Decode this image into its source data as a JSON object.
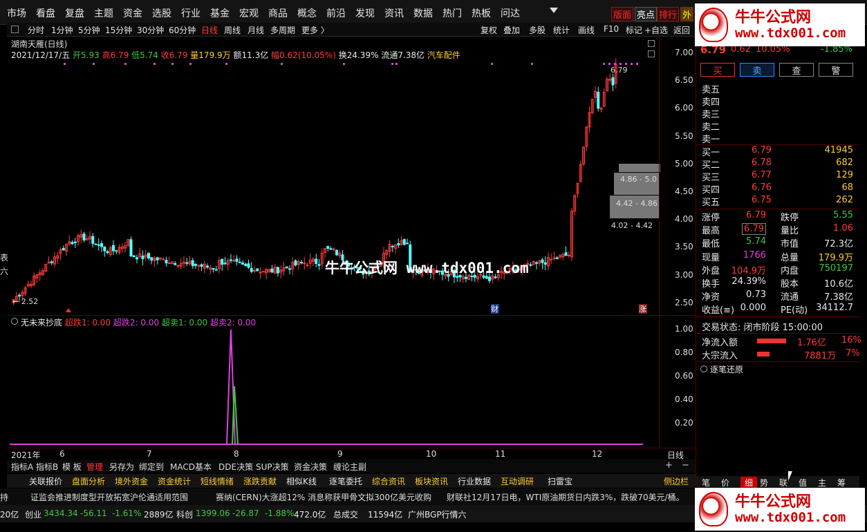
{
  "menubar": {
    "items": [
      "市场",
      "看盘",
      "复盘",
      "主题",
      "资金",
      "选股",
      "行业",
      "基金",
      "宏观",
      "商品",
      "概念",
      "前沿",
      "发现",
      "资讯",
      "数据",
      "热门",
      "热板",
      "问达"
    ],
    "right_tabs": [
      "版面",
      "亮点",
      "排行",
      "外"
    ]
  },
  "periodbar": {
    "items": [
      "分时",
      "1分钟",
      "5分钟",
      "15分钟",
      "30分钟",
      "60分钟",
      "日线",
      "周线",
      "月线",
      "多周期",
      "更多 〉"
    ],
    "right_items": [
      "复权",
      "叠加",
      "多股",
      "统计",
      "画线",
      "F10",
      "标记",
      "+自选",
      "返回"
    ]
  },
  "chart_header": {
    "stock": "湖南天雁(日线)",
    "date": "2021/12/17/五",
    "open": "开5.93",
    "high": "高6.79",
    "low": "低5.74",
    "close": "收6.79",
    "vol": "量179.9万",
    "amount": "额11.3亿",
    "amp": "幅0.62(10.05%)",
    "turnover": "换24.39%",
    "float": "流通7.38亿",
    "sector": "汽车配件"
  },
  "chart_data": {
    "type": "candlestick",
    "ylim": [
      2.3,
      7.15
    ],
    "yticks": [
      "7.00",
      "6.50",
      "6.00",
      "5.50",
      "5.00",
      "4.50",
      "4.00",
      "3.50",
      "3.00",
      "2.50"
    ],
    "xlabels": [
      "2021年",
      "6",
      "7",
      "8",
      "9",
      "10",
      "11",
      "12",
      "日线"
    ],
    "annotations": {
      "high_label": "6.79",
      "low_label": "2.52",
      "range_labels": [
        "4.86 - 5.0",
        "4.42 - 4.86",
        "4.02 - 4.42"
      ],
      "marker_cai": "财",
      "marker_zhang": "涨"
    }
  },
  "sub_chart": {
    "name": "无未来抄底",
    "series": [
      "超跌1: 0.00",
      "超跌2: 0.00",
      "超卖1: 0.00",
      "超卖2: 0.00"
    ],
    "yticks": [
      "1.00",
      "0.80",
      "0.60",
      "0.40",
      "0.20"
    ]
  },
  "indicator_tabs": [
    "指标A",
    "指标B",
    "模 板",
    "管理",
    "另存为",
    "绑定到",
    "MACD基本",
    "DDE决策",
    "SUP决策",
    "资金决策",
    "缠论主副"
  ],
  "bottom_tabs": [
    "关联报价",
    "盘面分析",
    "境外资金",
    "资金统计",
    "短线情绪",
    "涨跌贡献",
    "相似K线",
    "逐笔委托",
    "综合资讯",
    "板块资讯",
    "行业数据",
    "互动调研",
    "扫雷宝",
    "侧边栏"
  ],
  "news": [
    "证监会推进制度型开放拓宽沪伦通适用范围",
    "赛纳(CERN)大涨超12% 消息称获甲骨文拟300亿美元收购",
    "财联社12月17日电，WTI原油期货日内跌3%，跌破70美元/桶。"
  ],
  "status": {
    "left": "20亿",
    "cy_label": "创业",
    "cy_val": "3434.34",
    "cy_chg": "-56.11",
    "cy_pct": "-1.61%",
    "cy_amt": "2889亿",
    "kc_label": "科创",
    "kc_val": "1399.06",
    "kc_chg": "-26.87",
    "kc_pct": "-1.88%",
    "kc_amt": "472.0亿",
    "total_label": "总成交",
    "total_amt": "11594亿",
    "extra": "广州BGP行情六"
  },
  "quote": {
    "price": "6.79",
    "chg": "0.62",
    "pct": "10.05%",
    "idx_pct": "-1.85%",
    "buttons": [
      "买",
      "卖",
      "查",
      "警"
    ],
    "asks": [
      "卖五",
      "卖四",
      "卖三",
      "卖二",
      "卖一"
    ],
    "bids": [
      {
        "l": "买一",
        "p": "6.79",
        "v": "41945"
      },
      {
        "l": "买二",
        "p": "6.78",
        "v": "682"
      },
      {
        "l": "买三",
        "p": "6.77",
        "v": "129"
      },
      {
        "l": "买四",
        "p": "6.76",
        "v": "68"
      },
      {
        "l": "买五",
        "p": "6.75",
        "v": "262"
      }
    ],
    "stats": [
      [
        "涨停",
        "6.79",
        "跌停",
        "5.55"
      ],
      [
        "最高",
        "6.79",
        "量比",
        "1.06"
      ],
      [
        "最低",
        "5.74",
        "市值",
        "72.3亿"
      ],
      [
        "现量",
        "1766",
        "总量",
        "179.9万"
      ],
      [
        "外盘",
        "104.9万",
        "内盘",
        "750197"
      ],
      [
        "换手",
        "24.39%",
        "股本",
        "10.6亿"
      ],
      [
        "净资",
        "0.73",
        "流通",
        "7.38亿"
      ],
      [
        "收益(≡)",
        "0.000",
        "PE(动)",
        "34112.7"
      ]
    ],
    "trade_state": "交易状态: 闭市阶段 15:00:00",
    "net_in_label": "净流入额",
    "net_in_val": "1.76亿",
    "net_in_pct": "16%",
    "block_label": "大宗流入",
    "block_val": "7881万",
    "block_pct": "7%",
    "tick_label": "逐笔还原",
    "bottom_tabs": [
      "笔",
      "价",
      "细",
      "势",
      "联",
      "值",
      "主",
      "筹"
    ]
  },
  "watermark": {
    "brand": "牛牛公式网",
    "url": "www.tdx001.com",
    "center": "牛牛公式网 www.tdx001.com"
  }
}
